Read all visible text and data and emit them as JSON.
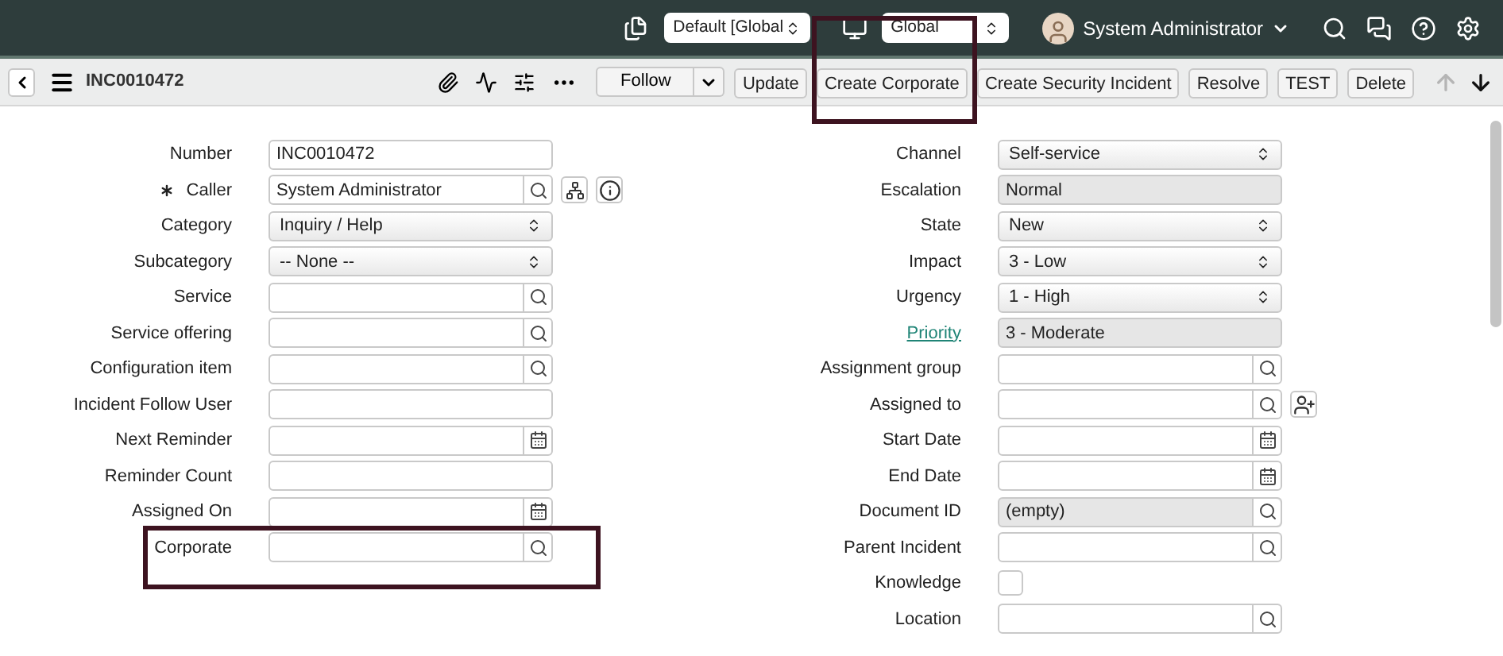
{
  "header": {
    "selects": [
      {
        "value": "Default [Global"
      },
      {
        "value": "Global"
      }
    ],
    "user": {
      "name": "System Administrator"
    }
  },
  "toolbar": {
    "record": "INC0010472",
    "follow": "Follow",
    "buttons": [
      "Update",
      "Create Corporate",
      "Create Security Incident",
      "Resolve",
      "TEST",
      "Delete"
    ],
    "nav": [
      {
        "kind": "up",
        "disabled": true
      },
      {
        "kind": "down",
        "disabled": false
      }
    ]
  },
  "form": {
    "left": [
      {
        "label": "Number",
        "kind": "text",
        "value": "INC0010472",
        "required": false,
        "link": false
      },
      {
        "label": "Caller",
        "kind": "reference",
        "value": "System Administrator",
        "required": true,
        "link": false,
        "extras": [
          {
            "kind": "tree"
          },
          {
            "kind": "info"
          }
        ]
      },
      {
        "label": "Category",
        "kind": "select",
        "value": "Inquiry / Help",
        "required": false,
        "link": false
      },
      {
        "label": "Subcategory",
        "kind": "select",
        "value": "-- None --",
        "required": false,
        "link": false
      },
      {
        "label": "Service",
        "kind": "reference",
        "required": false,
        "link": false
      },
      {
        "label": "Service offering",
        "kind": "reference",
        "required": false,
        "link": false
      },
      {
        "label": "Configuration item",
        "kind": "reference",
        "required": false,
        "link": false
      },
      {
        "label": "Incident Follow User",
        "kind": "text",
        "required": false,
        "link": false
      },
      {
        "label": "Next Reminder",
        "kind": "date",
        "required": false,
        "link": false
      },
      {
        "label": "Reminder Count",
        "kind": "text",
        "required": false,
        "link": false
      },
      {
        "label": "Assigned On",
        "kind": "date",
        "required": false,
        "link": false
      },
      {
        "label": "Corporate",
        "kind": "reference",
        "required": false,
        "link": false
      }
    ],
    "right": [
      {
        "label": "Channel",
        "kind": "select",
        "value": "Self-service",
        "required": false,
        "link": false
      },
      {
        "label": "Escalation",
        "kind": "readonly",
        "value": "Normal",
        "required": false,
        "link": false
      },
      {
        "label": "State",
        "kind": "select",
        "value": "New",
        "required": false,
        "link": false
      },
      {
        "label": "Impact",
        "kind": "select",
        "value": "3 - Low",
        "required": false,
        "link": false
      },
      {
        "label": "Urgency",
        "kind": "select",
        "value": "1 - High",
        "required": false,
        "link": false
      },
      {
        "label": "Priority",
        "kind": "readonly",
        "value": "3 - Moderate",
        "required": false,
        "link": true
      },
      {
        "label": "Assignment group",
        "kind": "reference",
        "required": false,
        "link": false
      },
      {
        "label": "Assigned to",
        "kind": "reference",
        "required": false,
        "link": false,
        "extras": [
          {
            "kind": "adduser"
          }
        ]
      },
      {
        "label": "Start Date",
        "kind": "date",
        "required": false,
        "link": false
      },
      {
        "label": "End Date",
        "kind": "date",
        "required": false,
        "link": false
      },
      {
        "label": "Document ID",
        "kind": "readonly_reference",
        "value": "(empty)",
        "required": false,
        "link": false
      },
      {
        "label": "Parent Incident",
        "kind": "reference",
        "required": false,
        "link": false
      },
      {
        "label": "Knowledge",
        "kind": "checkbox",
        "checked": false,
        "required": false,
        "link": false
      },
      {
        "label": "Location",
        "kind": "reference",
        "required": false,
        "link": false
      }
    ]
  }
}
